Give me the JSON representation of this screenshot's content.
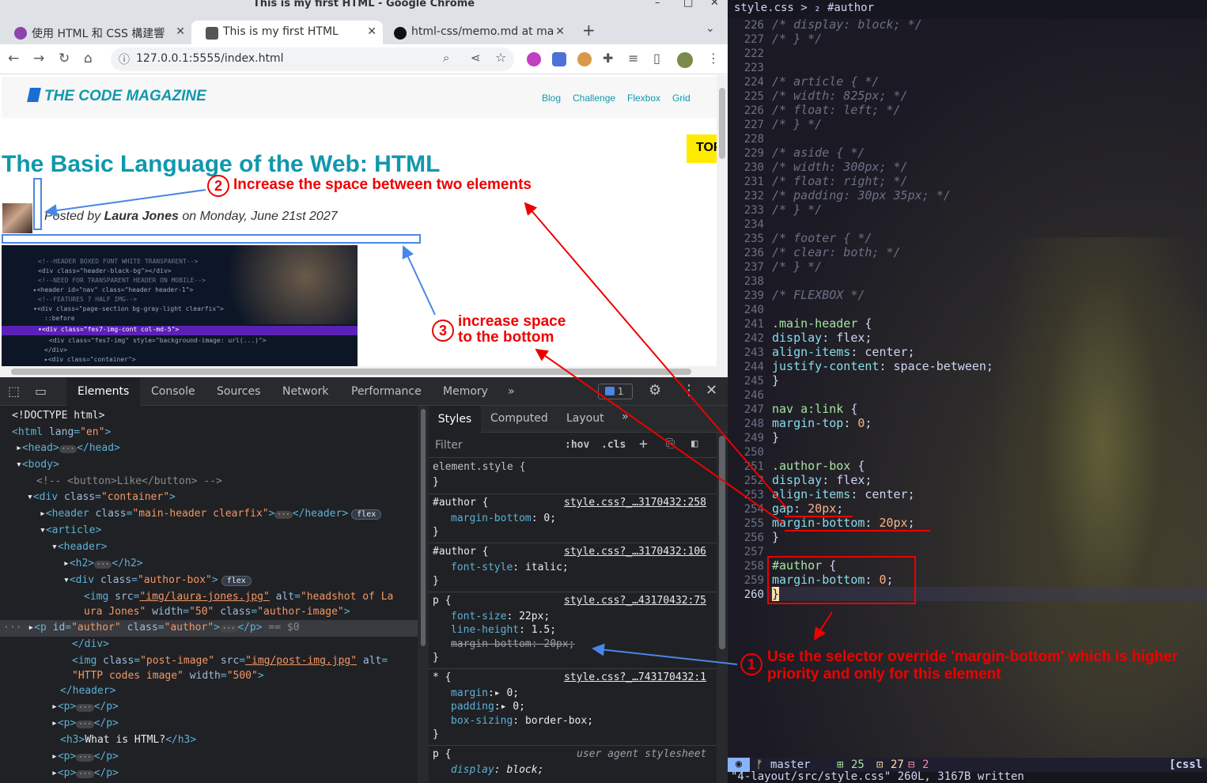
{
  "window": {
    "title": "This is my first HTML - Google Chrome"
  },
  "tabs": [
    {
      "label": "使用 HTML 和 CSS 構建響"
    },
    {
      "label": "This is my first HTML"
    },
    {
      "label": "html-css/memo.md at ma"
    }
  ],
  "omnibox": {
    "url": "127.0.0.1:5555/index.html"
  },
  "page": {
    "logo": "THE CODE MAGAZINE",
    "nav": [
      "Blog",
      "Challenge",
      "Flexbox",
      "Grid"
    ],
    "top_button": "TOP",
    "title": "The Basic Language of the Web: HTML",
    "author_prefix": "Posted by ",
    "author_name": "Laura Jones",
    "author_suffix": " on Monday, June 21st 2027"
  },
  "devtools": {
    "tabs": [
      "Elements",
      "Console",
      "Sources",
      "Network",
      "Performance",
      "Memory"
    ],
    "issues_count": "1",
    "styles_tabs": [
      "Styles",
      "Computed",
      "Layout"
    ],
    "filter_placeholder": "Filter",
    "hov": ":hov",
    "cls": ".cls",
    "dom": [
      "<!DOCTYPE html>",
      "<!-- <button>Like</button> -->",
      "What is HTML?"
    ],
    "rules": [
      {
        "selector": "element.style {",
        "source": ""
      },
      {
        "selector": "#author {",
        "source": "style.css?_…3170432:258",
        "decl": "margin-bottom: 0;"
      },
      {
        "selector": "#author {",
        "source": "style.css?_…3170432:106",
        "decl": "font-style: italic;"
      },
      {
        "selector": "p {",
        "source": "style.css?_…43170432:75",
        "decl": "font-size: 22px;"
      },
      {
        "selector": "* {",
        "source": "style.css?_…743170432:1"
      },
      {
        "selector": "p {",
        "source": "user agent stylesheet",
        "decl": "display: block;"
      }
    ]
  },
  "editor": {
    "breadcrumb": "style.css > ₂ #author",
    "branch": "master",
    "stats": [
      "25",
      "27",
      "2"
    ],
    "mode": "[cssl",
    "cmdline": "\"4-layout/src/style.css\" 260L, 3167B written"
  },
  "annotations": {
    "a1": "Use the selector override 'margin-bottom' which is higher priority and only for this element",
    "a2": "Increase the space between two elements",
    "a3_line1": "increase space",
    "a3_line2": "to the bottom"
  }
}
